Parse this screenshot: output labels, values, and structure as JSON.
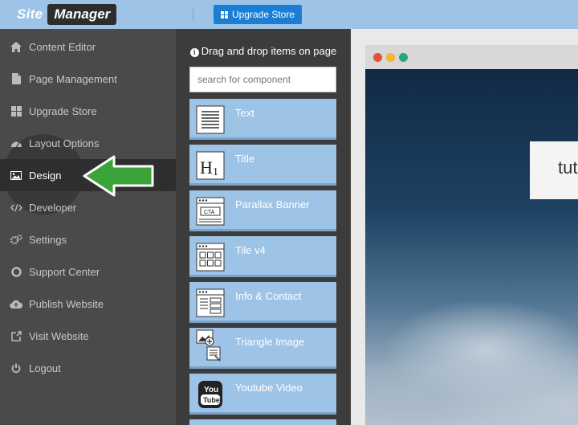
{
  "app": {
    "logo_left": "Site",
    "logo_right": "Manager"
  },
  "header": {
    "upgrade_label": "Upgrade Store"
  },
  "sidebar": {
    "items": [
      {
        "label": "Content Editor",
        "icon": "home-icon"
      },
      {
        "label": "Page Management",
        "icon": "file-icon"
      },
      {
        "label": "Upgrade Store",
        "icon": "grid-icon"
      },
      {
        "label": "Layout Options",
        "icon": "dashboard-icon"
      },
      {
        "label": "Design",
        "icon": "image-icon",
        "active": true
      },
      {
        "label": "Developer",
        "icon": "code-icon"
      },
      {
        "label": "Settings",
        "icon": "gears-icon"
      },
      {
        "label": "Support Center",
        "icon": "lifebuoy-icon"
      },
      {
        "label": "Publish Website",
        "icon": "cloud-upload-icon"
      },
      {
        "label": "Visit Website",
        "icon": "external-link-icon"
      },
      {
        "label": "Logout",
        "icon": "power-icon"
      }
    ]
  },
  "panel": {
    "heading": "Drag and drop items on page",
    "search_placeholder": "search for component",
    "components": [
      {
        "label": "Text",
        "icon": "text-block-icon"
      },
      {
        "label": "Title",
        "icon": "heading-h1-icon"
      },
      {
        "label": "Parallax Banner",
        "icon": "cta-banner-icon"
      },
      {
        "label": "Tile v4",
        "icon": "tile-grid-icon"
      },
      {
        "label": "Info & Contact",
        "icon": "contact-form-icon"
      },
      {
        "label": "Triangle Image",
        "icon": "add-image-icon"
      },
      {
        "label": "Youtube Video",
        "icon": "youtube-icon"
      }
    ]
  },
  "preview": {
    "hero_text": "tut",
    "dots": [
      "#e74c3c",
      "#f5b52e",
      "#27a87a"
    ]
  },
  "colors": {
    "accent": "#9dc3e6",
    "button": "#1a7fd4",
    "arrow": "#3aa33a"
  }
}
